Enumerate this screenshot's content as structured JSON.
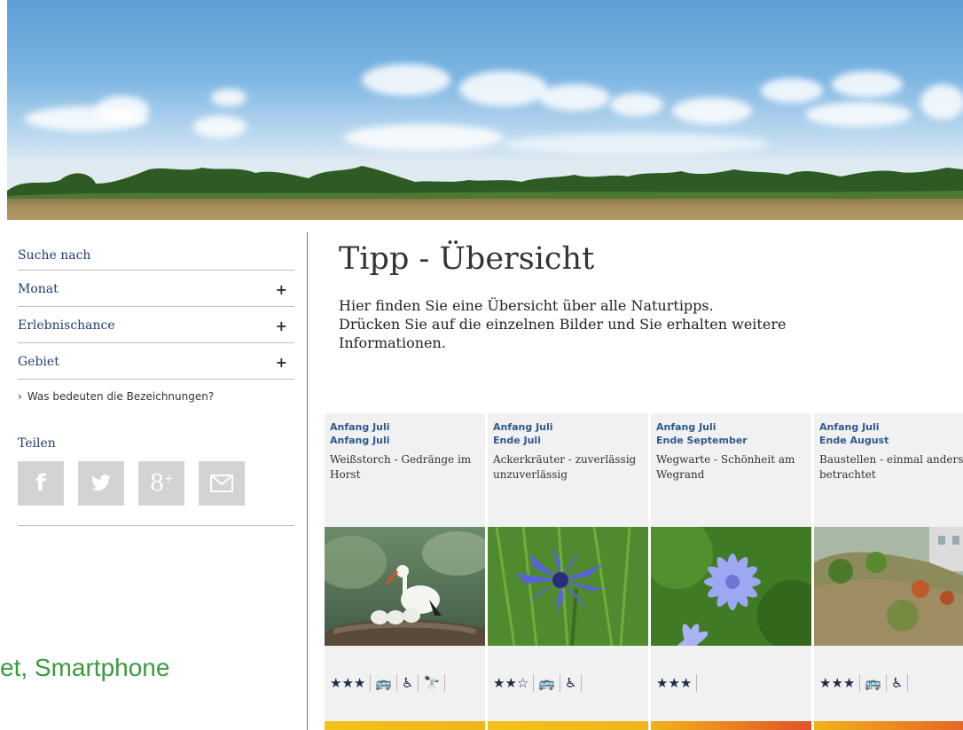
{
  "sidebar": {
    "search_title": "Suche nach",
    "filters": [
      {
        "label": "Monat",
        "expand": "+"
      },
      {
        "label": "Erlebnischance",
        "expand": "+"
      },
      {
        "label": "Gebiet",
        "expand": "+"
      }
    ],
    "help_link": "Was bedeuten die Bezeichnungen?",
    "share_title": "Teilen",
    "share_buttons": [
      {
        "icon": "facebook-icon",
        "glyph": "f"
      },
      {
        "icon": "twitter-icon",
        "glyph": "🐦"
      },
      {
        "icon": "googleplus-icon",
        "glyph": "8⁺"
      },
      {
        "icon": "mail-icon",
        "glyph": "✉"
      }
    ]
  },
  "overlay_text": "et, Smartphone",
  "main": {
    "title": "Tipp - Übersicht",
    "intro_line1": "Hier finden Sie eine Übersicht über alle Naturtipps.",
    "intro_line2": "Drücken Sie auf die einzelnen Bilder und Sie erhalten weitere Informationen."
  },
  "cards": [
    {
      "start": "Anfang Juli",
      "end": "Anfang Juli",
      "title": "Weißstorch - Gedränge im Horst",
      "stars": "★★★",
      "icons": [
        "🚌",
        "♿",
        "🔭"
      ],
      "band_color": "#f2c21a"
    },
    {
      "start": "Anfang Juli",
      "end": "Ende Juli",
      "title": "Ackerkräuter - zuverlässig unzuverlässig",
      "stars": "★★☆",
      "icons": [
        "🚌",
        "♿"
      ],
      "band_color": "#f2c21a"
    },
    {
      "start": "Anfang Juli",
      "end": "Ende September",
      "title": "Wegwarte - Schönheit am Wegrand",
      "stars": "★★★",
      "icons": [],
      "band_color": "#e57a2a"
    },
    {
      "start": "Anfang Juli",
      "end": "Ende August",
      "title": "Baustellen - einmal anders betrachtet",
      "stars": "★★★",
      "icons": [
        "🚌",
        "♿"
      ],
      "band_color": "#e9832c"
    }
  ]
}
